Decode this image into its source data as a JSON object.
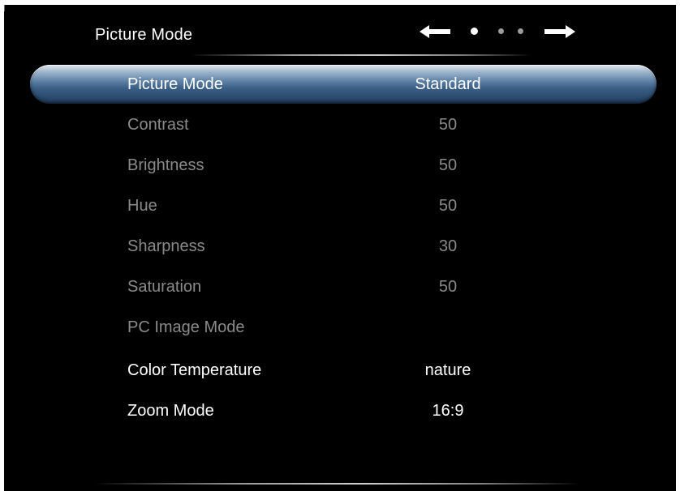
{
  "header": {
    "title": "Picture Mode",
    "pager": {
      "current_page": 1,
      "total_pages": 3
    }
  },
  "menu": {
    "items": [
      {
        "label": "Picture Mode",
        "value": "Standard",
        "state": "selected"
      },
      {
        "label": "Contrast",
        "value": "50",
        "state": "disabled"
      },
      {
        "label": "Brightness",
        "value": "50",
        "state": "disabled"
      },
      {
        "label": "Hue",
        "value": "50",
        "state": "disabled"
      },
      {
        "label": "Sharpness",
        "value": "30",
        "state": "disabled"
      },
      {
        "label": "Saturation",
        "value": "50",
        "state": "disabled"
      },
      {
        "label": "PC Image Mode",
        "value": "",
        "state": "disabled"
      },
      {
        "label": "Color Temperature",
        "value": "nature",
        "state": "enabled"
      },
      {
        "label": "Zoom Mode",
        "value": "16:9",
        "state": "enabled"
      }
    ]
  },
  "colors": {
    "background": "#000000",
    "selected_bar": "#3a5e85",
    "text_enabled": "#ffffff",
    "text_disabled": "#8a8a8a"
  },
  "icons": {
    "prev": "arrow-left-icon",
    "next": "arrow-right-icon"
  }
}
